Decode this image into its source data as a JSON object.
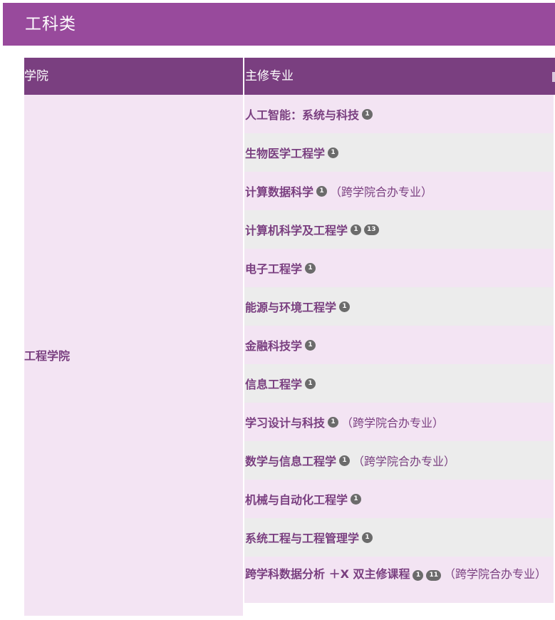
{
  "banner": {
    "title": "工科类"
  },
  "table": {
    "headers": {
      "college": "学院",
      "major": "主修专业"
    },
    "college": "工程学院",
    "rows": [
      {
        "name": "人工智能：系统与科技",
        "badges": [
          "1"
        ],
        "note": ""
      },
      {
        "name": "生物医学工程学",
        "badges": [
          "1"
        ],
        "note": ""
      },
      {
        "name": "计算数据科学",
        "badges": [
          "1"
        ],
        "note": "（跨学院合办专业）"
      },
      {
        "name": "计算机科学及工程学",
        "badges": [
          "1",
          "13"
        ],
        "note": ""
      },
      {
        "name": "电子工程学",
        "badges": [
          "1"
        ],
        "note": ""
      },
      {
        "name": "能源与环境工程学",
        "badges": [
          "1"
        ],
        "note": ""
      },
      {
        "name": "金融科技学",
        "badges": [
          "1"
        ],
        "note": ""
      },
      {
        "name": "信息工程学",
        "badges": [
          "1"
        ],
        "note": ""
      },
      {
        "name": "学习设计与科技",
        "badges": [
          "1"
        ],
        "note": "（跨学院合办专业）"
      },
      {
        "name": "数学与信息工程学",
        "badges": [
          "1"
        ],
        "note": "（跨学院合办专业）"
      },
      {
        "name": "机械与自动化工程学",
        "badges": [
          "1"
        ],
        "note": ""
      },
      {
        "name": "系统工程与工程管理学",
        "badges": [
          "1"
        ],
        "note": ""
      },
      {
        "name": "跨学科数据分析 ＋X 双主修课程",
        "badges": [
          "1",
          "11"
        ],
        "note": "（跨学院合办专业）"
      }
    ]
  },
  "colors": {
    "banner": "#984a9c",
    "header": "#7a3f80",
    "row_odd": "#f3e4f3",
    "row_even": "#ececec",
    "text": "#7a3f80",
    "badge": "#6b6b6b"
  }
}
